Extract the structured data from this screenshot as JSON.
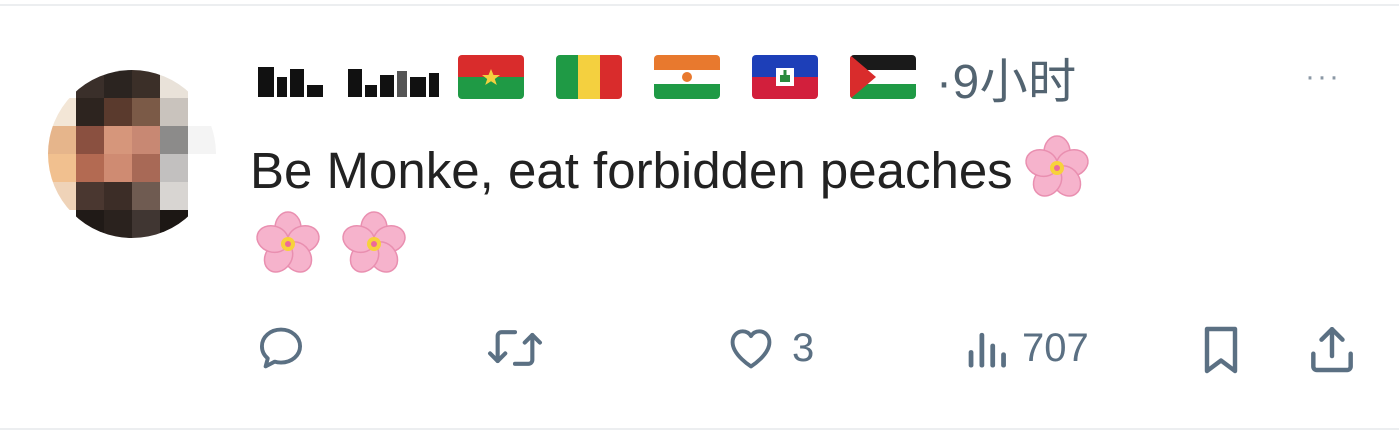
{
  "tweet": {
    "author_name": "",
    "flags": [
      {
        "icon": "burkina-faso-flag-icon"
      },
      {
        "icon": "mali-flag-icon"
      },
      {
        "icon": "niger-flag-icon"
      },
      {
        "icon": "haiti-flag-icon"
      },
      {
        "icon": "palestine-flag-icon"
      }
    ],
    "timestamp": "·9小时",
    "more_label": "···",
    "text": "Be Monke, eat forbidden peaches",
    "emojis": [
      "cherry-blossom-icon",
      "cherry-blossom-icon",
      "cherry-blossom-icon"
    ],
    "actions": {
      "reply": {
        "icon": "reply-icon",
        "count": ""
      },
      "retweet": {
        "icon": "retweet-icon",
        "count": ""
      },
      "like": {
        "icon": "heart-icon",
        "count": "3"
      },
      "views": {
        "icon": "views-icon",
        "count": "707"
      },
      "bookmark": {
        "icon": "bookmark-icon"
      },
      "share": {
        "icon": "share-icon"
      }
    }
  },
  "colors": {
    "text": "#222222",
    "muted": "#536471",
    "icon": "#5b7083",
    "divider": "#eceef0"
  }
}
